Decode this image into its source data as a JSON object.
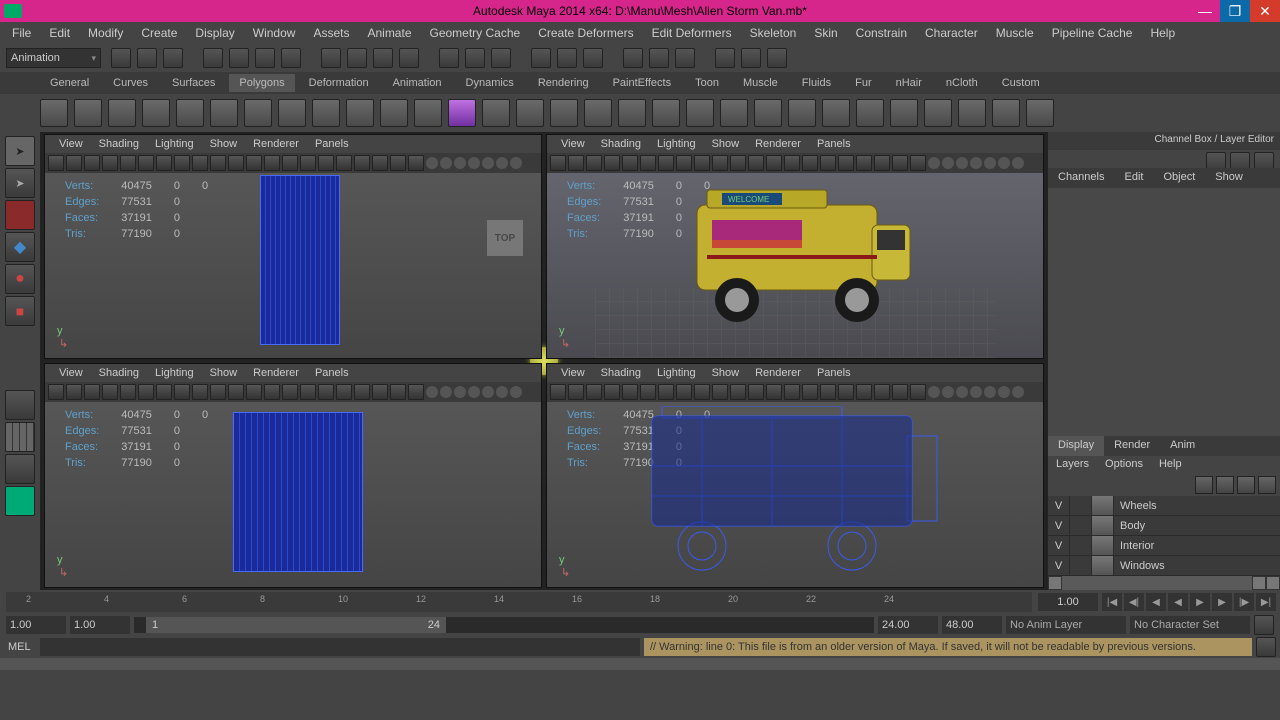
{
  "window": {
    "title": "Autodesk Maya 2014 x64: D:\\Manu\\Mesh\\Alien Storm Van.mb*"
  },
  "menus": [
    "File",
    "Edit",
    "Modify",
    "Create",
    "Display",
    "Window",
    "Assets",
    "Animate",
    "Geometry Cache",
    "Create Deformers",
    "Edit Deformers",
    "Skeleton",
    "Skin",
    "Constrain",
    "Character",
    "Muscle",
    "Pipeline Cache",
    "Help"
  ],
  "mode": "Animation",
  "shelves": [
    "General",
    "Curves",
    "Surfaces",
    "Polygons",
    "Deformation",
    "Animation",
    "Dynamics",
    "Rendering",
    "PaintEffects",
    "Toon",
    "Muscle",
    "Fluids",
    "Fur",
    "nHair",
    "nCloth",
    "Custom"
  ],
  "active_shelf": "Polygons",
  "vp_menu": [
    "View",
    "Shading",
    "Lighting",
    "Show",
    "Renderer",
    "Panels"
  ],
  "stats": {
    "verts_l": "Verts:",
    "verts": "40475",
    "edges_l": "Edges:",
    "edges": "77531",
    "faces_l": "Faces:",
    "faces": "37191",
    "tris_l": "Tris:",
    "tris": "77190",
    "zero": "0"
  },
  "top_label": "TOP",
  "van_sign": "WELCOME",
  "channel_title": "Channel Box / Layer Editor",
  "channel_tabs": [
    "Channels",
    "Edit",
    "Object",
    "Show"
  ],
  "layer_tabs": [
    "Display",
    "Render",
    "Anim"
  ],
  "layer_sub": [
    "Layers",
    "Options",
    "Help"
  ],
  "layers": [
    {
      "v": "V",
      "name": "Wheels"
    },
    {
      "v": "V",
      "name": "Body"
    },
    {
      "v": "V",
      "name": "Interior"
    },
    {
      "v": "V",
      "name": "Windows"
    }
  ],
  "ticks": [
    "2",
    "4",
    "6",
    "8",
    "10",
    "12",
    "14",
    "16",
    "18",
    "20",
    "22",
    "24"
  ],
  "cur_frame": "1.00",
  "range": {
    "start": "1.00",
    "pstart": "1.00",
    "s1": "1",
    "s2": "24",
    "pend": "24.00",
    "end": "48.00"
  },
  "anim_layer": "No Anim Layer",
  "char_set": "No Character Set",
  "cmd_label": "MEL",
  "warning": "// Warning: line 0: This file is from an older version of Maya.  If saved, it will not be readable by previous versions."
}
